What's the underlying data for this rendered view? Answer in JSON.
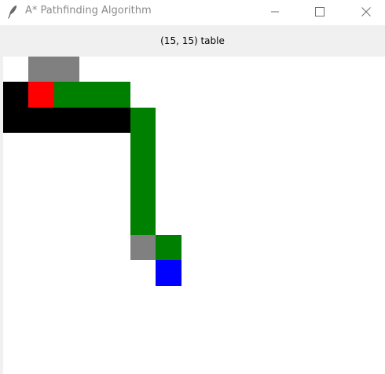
{
  "window": {
    "title": "A* Pathfinding Algorithm",
    "controls": {
      "minimize_icon": "minimize-icon",
      "maximize_icon": "maximize-icon",
      "close_icon": "close-icon"
    }
  },
  "header": {
    "label": "(15, 15) table"
  },
  "grid": {
    "colors": {
      "barrier": "#000000",
      "start": "#ff0000",
      "end": "#0000ff",
      "path": "#008000",
      "closed": "#808080",
      "open": "#ffffff"
    },
    "cells": [
      {
        "row": 0,
        "col": 1,
        "state": "closed"
      },
      {
        "row": 0,
        "col": 2,
        "state": "closed"
      },
      {
        "row": 1,
        "col": 0,
        "state": "barrier"
      },
      {
        "row": 1,
        "col": 1,
        "state": "start"
      },
      {
        "row": 1,
        "col": 2,
        "state": "path"
      },
      {
        "row": 1,
        "col": 3,
        "state": "path"
      },
      {
        "row": 1,
        "col": 4,
        "state": "path"
      },
      {
        "row": 2,
        "col": 0,
        "state": "barrier"
      },
      {
        "row": 2,
        "col": 1,
        "state": "barrier"
      },
      {
        "row": 2,
        "col": 2,
        "state": "barrier"
      },
      {
        "row": 2,
        "col": 3,
        "state": "barrier"
      },
      {
        "row": 2,
        "col": 4,
        "state": "barrier"
      },
      {
        "row": 2,
        "col": 5,
        "state": "path"
      },
      {
        "row": 3,
        "col": 5,
        "state": "path"
      },
      {
        "row": 4,
        "col": 5,
        "state": "path"
      },
      {
        "row": 5,
        "col": 5,
        "state": "path"
      },
      {
        "row": 6,
        "col": 5,
        "state": "path"
      },
      {
        "row": 7,
        "col": 5,
        "state": "closed"
      },
      {
        "row": 7,
        "col": 6,
        "state": "path"
      },
      {
        "row": 8,
        "col": 6,
        "state": "end"
      }
    ]
  }
}
